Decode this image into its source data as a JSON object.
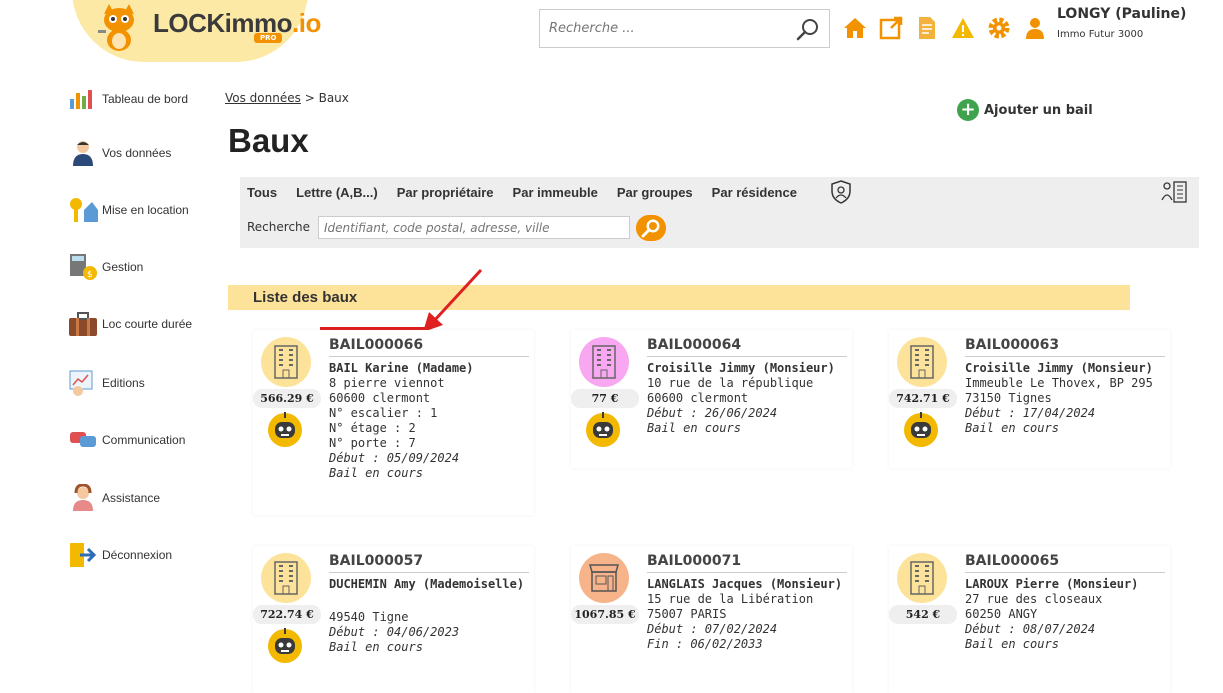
{
  "logo": {
    "text_main": "LOCKimmo",
    "text_suffix": ".io",
    "badge": "PRO"
  },
  "header": {
    "search_placeholder": "Recherche ...",
    "user_name": "LONGY (Pauline)",
    "user_company": "Immo Futur 3000"
  },
  "sidebar": {
    "items": [
      {
        "label": "Tableau de bord",
        "icon": "dashboard-icon"
      },
      {
        "label": "Vos données",
        "icon": "person-icon"
      },
      {
        "label": "Mise en location",
        "icon": "keys-icon"
      },
      {
        "label": "Gestion",
        "icon": "calculator-icon"
      },
      {
        "label": "Loc courte durée",
        "icon": "suitcase-icon"
      },
      {
        "label": "Editions",
        "icon": "report-icon"
      },
      {
        "label": "Communication",
        "icon": "chat-icon"
      },
      {
        "label": "Assistance",
        "icon": "support-icon"
      },
      {
        "label": "Déconnexion",
        "icon": "logout-icon"
      }
    ]
  },
  "breadcrumb": {
    "link": "Vos données",
    "separator": ">",
    "current": "Baux"
  },
  "page": {
    "title": "Baux",
    "add_label": "Ajouter un bail"
  },
  "filters": {
    "tabs": [
      "Tous",
      "Lettre (A,B...)",
      "Par propriétaire",
      "Par immeuble",
      "Par groupes",
      "Par résidence"
    ],
    "search_label": "Recherche",
    "search_placeholder": "Identifiant, code postal, adresse, ville"
  },
  "list_title": "Liste des baux",
  "colors": {
    "accent": "#f39200",
    "highlight": "#e02020",
    "header_band": "#fde39a"
  },
  "leases": [
    {
      "ref": "BAIL000066",
      "price": "566.29 €",
      "tenant": "BAIL Karine (Madame)",
      "lines": [
        "8 pierre viennot",
        "60600 clermont",
        "N° escalier : 1",
        "N° étage : 2",
        "N° porte : 7"
      ],
      "start": "Début : 05/09/2024",
      "end": "",
      "status": "Bail en cours",
      "icon_bg": "#fde39a"
    },
    {
      "ref": "BAIL000064",
      "price": "77 €",
      "tenant": "Croisille Jimmy (Monsieur)",
      "lines": [
        "10 rue de la république",
        "60600 clermont"
      ],
      "start": "Début : 26/06/2024",
      "end": "",
      "status": "Bail en cours",
      "icon_bg": "#f7a8f0"
    },
    {
      "ref": "BAIL000063",
      "price": "742.71 €",
      "tenant": "Croisille Jimmy (Monsieur)",
      "lines": [
        "Immeuble Le Thovex, BP 295",
        "73150 Tignes"
      ],
      "start": "Début : 17/04/2024",
      "end": "",
      "status": "Bail en cours",
      "icon_bg": "#fde39a"
    },
    {
      "ref": "BAIL000057",
      "price": "722.74 €",
      "tenant": "DUCHEMIN Amy (Mademoiselle)",
      "lines": [
        "",
        "49540 Tigne"
      ],
      "start": "Début : 04/06/2023",
      "end": "",
      "status": "Bail en cours",
      "icon_bg": "#fde39a"
    },
    {
      "ref": "BAIL000071",
      "price": "1067.85 €",
      "tenant": "LANGLAIS Jacques (Monsieur)",
      "lines": [
        "15 rue de la Libération",
        "75007 PARIS"
      ],
      "start": "Début : 07/02/2024",
      "end": "Fin : 06/02/2033",
      "status": "",
      "icon_bg": "#f7b48a"
    },
    {
      "ref": "BAIL000065",
      "price": "542 €",
      "tenant": "LAROUX Pierre (Monsieur)",
      "lines": [
        "27 rue des closeaux",
        "60250 ANGY"
      ],
      "start": "Début : 08/07/2024",
      "end": "",
      "status": "Bail en cours",
      "icon_bg": "#fde39a"
    }
  ]
}
